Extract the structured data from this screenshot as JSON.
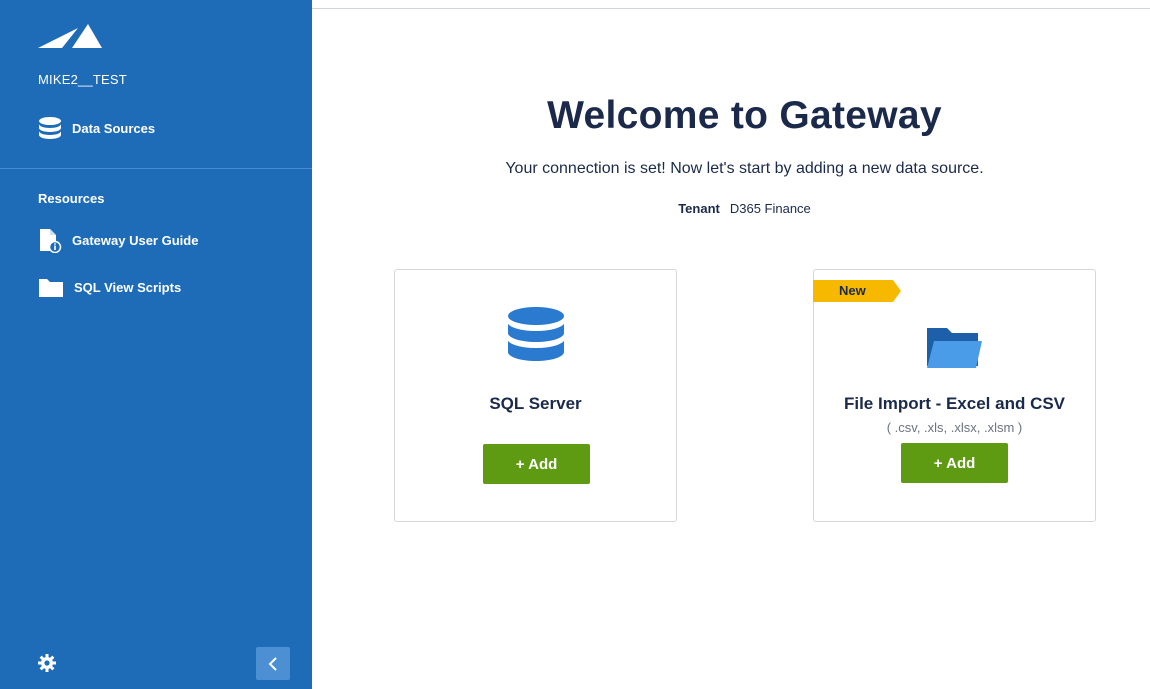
{
  "sidebar": {
    "tenant_name": "MIKE2__TEST",
    "data_sources_label": "Data Sources",
    "resources_title": "Resources",
    "resources": [
      {
        "label": "Gateway User Guide",
        "icon": "document-info-icon"
      },
      {
        "label": "SQL View Scripts",
        "icon": "folder-icon"
      }
    ]
  },
  "main": {
    "title": "Welcome to Gateway",
    "subtitle": "Your connection is set! Now let's start by adding a new data source.",
    "tenant_label": "Tenant",
    "tenant_value": "D365 Finance",
    "cards": [
      {
        "title": "SQL Server",
        "button": "+ Add",
        "icon": "database-icon"
      },
      {
        "title": "File Import - Excel and CSV",
        "subtitle": "( .csv, .xls, .xlsx, .xlsm )",
        "button": "+ Add",
        "badge": "New",
        "icon": "folder-icon"
      }
    ]
  },
  "colors": {
    "sidebar": "#1e6bb8",
    "accent_green": "#5e9a12",
    "badge_yellow": "#f7b800",
    "heading": "#1b2a4a"
  }
}
